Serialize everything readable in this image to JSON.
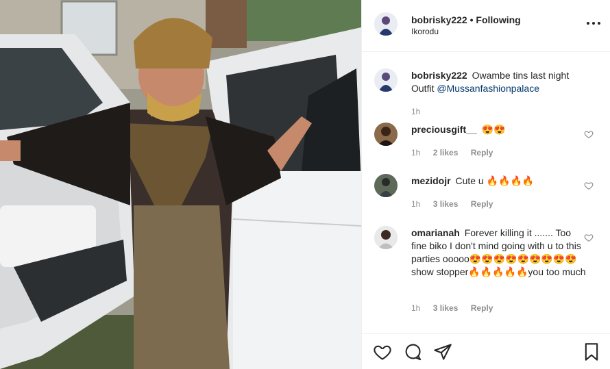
{
  "post": {
    "username": "bobrisky222",
    "separator": "•",
    "follow_state": "Following",
    "location": "Ikorodu",
    "more_icon": "more-options-icon",
    "caption": {
      "username": "bobrisky222",
      "text": "Owambe tins last night Outfit ",
      "mention": "@Mussanfashionpalace",
      "time": "1h"
    }
  },
  "comments": [
    {
      "username": "preciousgift__",
      "text": "😍😍",
      "time": "1h",
      "likes": "2 likes",
      "reply": "Reply"
    },
    {
      "username": "mezidojr",
      "text": "Cute u 🔥🔥🔥🔥",
      "time": "1h",
      "likes": "3 likes",
      "reply": "Reply"
    },
    {
      "username": "omarianah",
      "text": "Forever killing it ....... Too fine biko I don't mind going with u to this parties ooooo😍😍😍😍😍😍😍😍😍show stopper🔥🔥🔥🔥🔥you too much",
      "time": "1h",
      "likes": "3 likes",
      "reply": "Reply"
    }
  ],
  "actions": {
    "like_icon": "heart-icon",
    "comment_icon": "comment-icon",
    "share_icon": "share-icon",
    "save_icon": "bookmark-icon"
  },
  "colors": {
    "text": "#262626",
    "muted": "#8e8e8e",
    "link": "#00376b",
    "border": "#efefef"
  }
}
